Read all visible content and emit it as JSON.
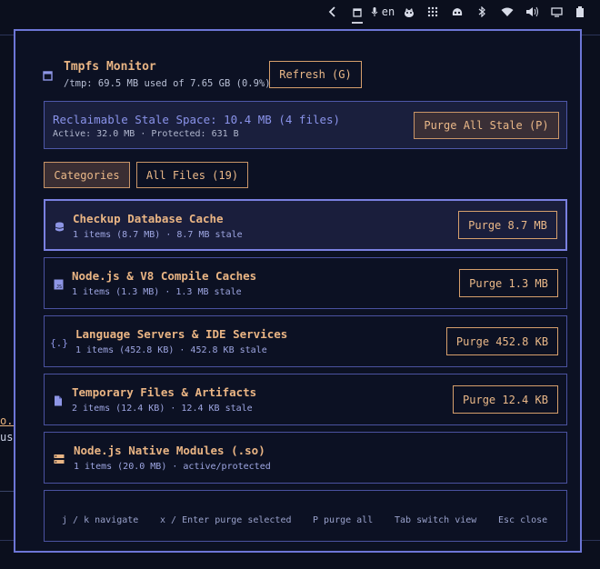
{
  "topbar": {
    "lang": "en"
  },
  "background": {
    "text1": "o.c",
    "text2": "usa"
  },
  "panel": {
    "title": "Tmpfs Monitor",
    "subtitle": "/tmp: 69.5 MB used of 7.65 GB (0.9%)",
    "refresh_label": "Refresh (G)",
    "banner": {
      "title": "Reclaimable Stale Space: 10.4 MB (4 files)",
      "sub": "Active: 32.0 MB · Protected: 631 B",
      "purge_all_label": "Purge All Stale (P)"
    },
    "tabs": [
      {
        "label": "Categories",
        "active": true
      },
      {
        "label": "All Files (19)",
        "active": false
      }
    ],
    "categories": [
      {
        "name": "Checkup Database Cache",
        "meta": "1 items (8.7 MB) · 8.7 MB stale",
        "button": "Purge 8.7 MB",
        "icon": "database-icon"
      },
      {
        "name": "Node.js & V8 Compile Caches",
        "meta": "1 items (1.3 MB) · 1.3 MB stale",
        "button": "Purge 1.3 MB",
        "icon": "javascript-file-icon"
      },
      {
        "name": "Language Servers & IDE Services",
        "meta": "1 items (452.8 KB) · 452.8 KB stale",
        "button": "Purge 452.8 KB",
        "icon": "code-braces-icon"
      },
      {
        "name": "Temporary Files & Artifacts",
        "meta": "2 items (12.4 KB) · 12.4 KB stale",
        "button": "Purge 12.4 KB",
        "icon": "file-icon"
      },
      {
        "name": "Node.js Native Modules (.so)",
        "meta": "1 items (20.0 MB) · active/protected",
        "button": "",
        "icon": "server-icon"
      }
    ],
    "footer": [
      "j / k navigate",
      "x / Enter purge selected",
      "P purge all",
      "Tab switch view",
      "Esc close"
    ]
  },
  "colors": {
    "accent": "#6d76d6",
    "text_orange": "#eab584",
    "meta_blue": "#9ea6e2",
    "panel_bg": "#0c1123"
  }
}
